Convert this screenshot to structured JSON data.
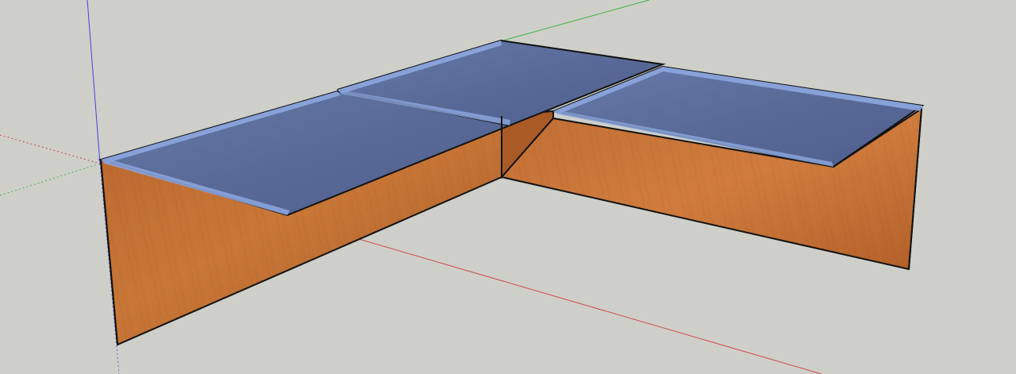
{
  "scene": {
    "background_color": "#cfcfca",
    "axes": {
      "red": "#d23a3a",
      "green": "#2fb32f",
      "blue": "#3b3be0"
    },
    "materials": {
      "wood": "#b8612a",
      "wood_dark": "#8f4719",
      "wood_light": "#cd7a3c",
      "glass": "#5f6f9e",
      "glass_edge": "#8aa4dc",
      "outline": "#111111"
    },
    "objects": [
      "left-desk-panel",
      "back-desk-panel",
      "right-desk-panel",
      "left-glass-top",
      "middle-glass-top",
      "right-glass-top"
    ]
  }
}
